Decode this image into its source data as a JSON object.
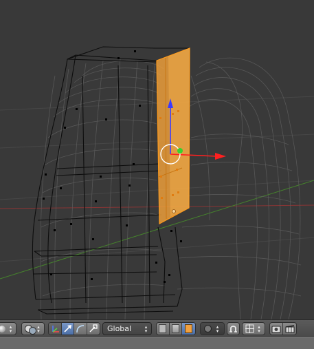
{
  "viewport": {
    "name": "3D Viewport",
    "colors": {
      "background": "#393939",
      "grid": "#4a4a4a",
      "x_axis": "#9b3b3b",
      "y_axis": "#4c8a2f",
      "mesh_wire": "#5a5a5a",
      "selected_wire": "#000000",
      "selected_face": "#f2a13a",
      "selected_edge": "#ff9a1a",
      "gizmo_x": "#ff2020",
      "gizmo_z": "#3a3aff",
      "gizmo_center": "#39d12f"
    }
  },
  "header": {
    "transform_orientation": {
      "value": "Global"
    },
    "icons": [
      "viewport-shading-icon",
      "pivot-point-icon",
      "manipulator-axis-icon",
      "translate-icon",
      "rotate-icon",
      "scale-icon",
      "vertex-select-icon",
      "edge-select-icon",
      "face-select-icon",
      "proportional-edit-icon",
      "snap-icon",
      "snap-target-icon",
      "render-icon",
      "render-animation-icon"
    ]
  }
}
